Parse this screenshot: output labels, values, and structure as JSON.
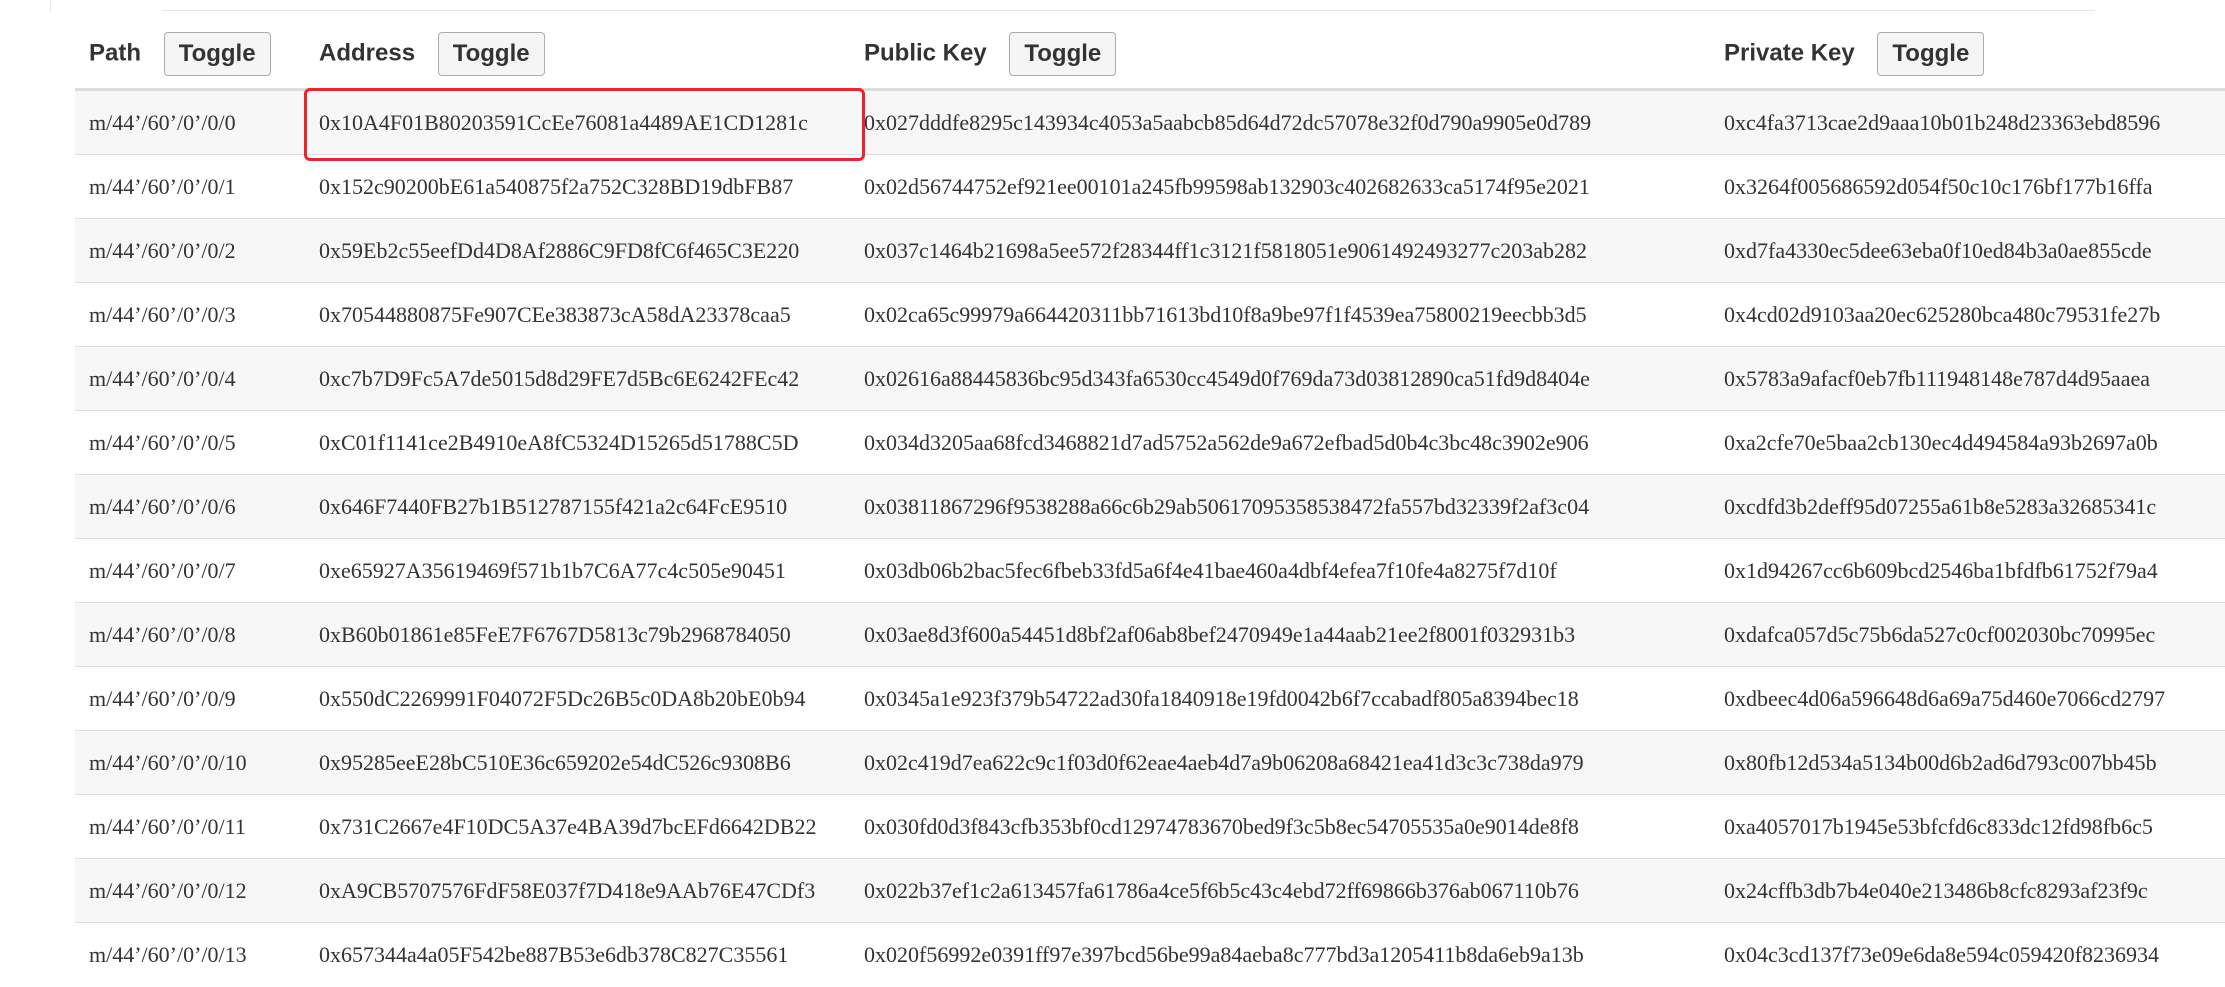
{
  "header": {
    "path_label": "Path",
    "address_label": "Address",
    "public_key_label": "Public Key",
    "private_key_label": "Private Key",
    "toggle_label": "Toggle"
  },
  "rows": [
    {
      "path": "m/44’/60’/0’/0/0",
      "address": "0x10A4F01B80203591CcEe76081a4489AE1CD1281c",
      "public_key": "0x027dddfe8295c143934c4053a5aabcb85d64d72dc57078e32f0d790a9905e0d789",
      "private_key": "0xc4fa3713cae2d9aaa10b01b248d23363ebd8596"
    },
    {
      "path": "m/44’/60’/0’/0/1",
      "address": "0x152c90200bE61a540875f2a752C328BD19dbFB87",
      "public_key": "0x02d56744752ef921ee00101a245fb99598ab132903c402682633ca5174f95e2021",
      "private_key": "0x3264f005686592d054f50c10c176bf177b16ffa"
    },
    {
      "path": "m/44’/60’/0’/0/2",
      "address": "0x59Eb2c55eefDd4D8Af2886C9FD8fC6f465C3E220",
      "public_key": "0x037c1464b21698a5ee572f28344ff1c3121f5818051e9061492493277c203ab282",
      "private_key": "0xd7fa4330ec5dee63eba0f10ed84b3a0ae855cde"
    },
    {
      "path": "m/44’/60’/0’/0/3",
      "address": "0x70544880875Fe907CEe383873cA58dA23378caa5",
      "public_key": "0x02ca65c99979a664420311bb71613bd10f8a9be97f1f4539ea75800219eecbb3d5",
      "private_key": "0x4cd02d9103aa20ec625280bca480c79531fe27b"
    },
    {
      "path": "m/44’/60’/0’/0/4",
      "address": "0xc7b7D9Fc5A7de5015d8d29FE7d5Bc6E6242FEc42",
      "public_key": "0x02616a88445836bc95d343fa6530cc4549d0f769da73d03812890ca51fd9d8404e",
      "private_key": "0x5783a9afacf0eb7fb111948148e787d4d95aaea"
    },
    {
      "path": "m/44’/60’/0’/0/5",
      "address": "0xC01f1141ce2B4910eA8fC5324D15265d51788C5D",
      "public_key": "0x034d3205aa68fcd3468821d7ad5752a562de9a672efbad5d0b4c3bc48c3902e906",
      "private_key": "0xa2cfe70e5baa2cb130ec4d494584a93b2697a0b"
    },
    {
      "path": "m/44’/60’/0’/0/6",
      "address": "0x646F7440FB27b1B512787155f421a2c64FcE9510",
      "public_key": "0x03811867296f9538288a66c6b29ab50617095358538472fa557bd32339f2af3c04",
      "private_key": "0xcdfd3b2deff95d07255a61b8e5283a32685341c"
    },
    {
      "path": "m/44’/60’/0’/0/7",
      "address": "0xe65927A35619469f571b1b7C6A77c4c505e90451",
      "public_key": "0x03db06b2bac5fec6fbeb33fd5a6f4e41bae460a4dbf4efea7f10fe4a8275f7d10f",
      "private_key": "0x1d94267cc6b609bcd2546ba1bfdfb61752f79a4"
    },
    {
      "path": "m/44’/60’/0’/0/8",
      "address": "0xB60b01861e85FeE7F6767D5813c79b2968784050",
      "public_key": "0x03ae8d3f600a54451d8bf2af06ab8bef2470949e1a44aab21ee2f8001f032931b3",
      "private_key": "0xdafca057d5c75b6da527c0cf002030bc70995ec"
    },
    {
      "path": "m/44’/60’/0’/0/9",
      "address": "0x550dC2269991F04072F5Dc26B5c0DA8b20bE0b94",
      "public_key": "0x0345a1e923f379b54722ad30fa1840918e19fd0042b6f7ccabadf805a8394bec18",
      "private_key": "0xdbeec4d06a596648d6a69a75d460e7066cd2797"
    },
    {
      "path": "m/44’/60’/0’/0/10",
      "address": "0x95285eeE28bC510E36c659202e54dC526c9308B6",
      "public_key": "0x02c419d7ea622c9c1f03d0f62eae4aeb4d7a9b06208a68421ea41d3c3c738da979",
      "private_key": "0x80fb12d534a5134b00d6b2ad6d793c007bb45b"
    },
    {
      "path": "m/44’/60’/0’/0/11",
      "address": "0x731C2667e4F10DC5A37e4BA39d7bcEFd6642DB22",
      "public_key": "0x030fd0d3f843cfb353bf0cd12974783670bed9f3c5b8ec54705535a0e9014de8f8",
      "private_key": "0xa4057017b1945e53bfcfd6c833dc12fd98fb6c5"
    },
    {
      "path": "m/44’/60’/0’/0/12",
      "address": "0xA9CB5707576FdF58E037f7D418e9AAb76E47CDf3",
      "public_key": "0x022b37ef1c2a613457fa61786a4ce5f6b5c43c4ebd72ff69866b376ab067110b76",
      "private_key": "0x24cffb3db7b4e040e213486b8cfc8293af23f9c"
    },
    {
      "path": "m/44’/60’/0’/0/13",
      "address": "0x657344a4a05F542be887B53e6db378C827C35561",
      "public_key": "0x020f56992e0391ff97e397bcd56be99a84aeba8c777bd3a1205411b8da6eb9a13b",
      "private_key": "0x04c3cd137f73e09e6da8e594c059420f8236934"
    }
  ],
  "colors": {
    "highlight": "#e8262b",
    "stripe": "#f7f7f7",
    "border": "#dddddd"
  }
}
